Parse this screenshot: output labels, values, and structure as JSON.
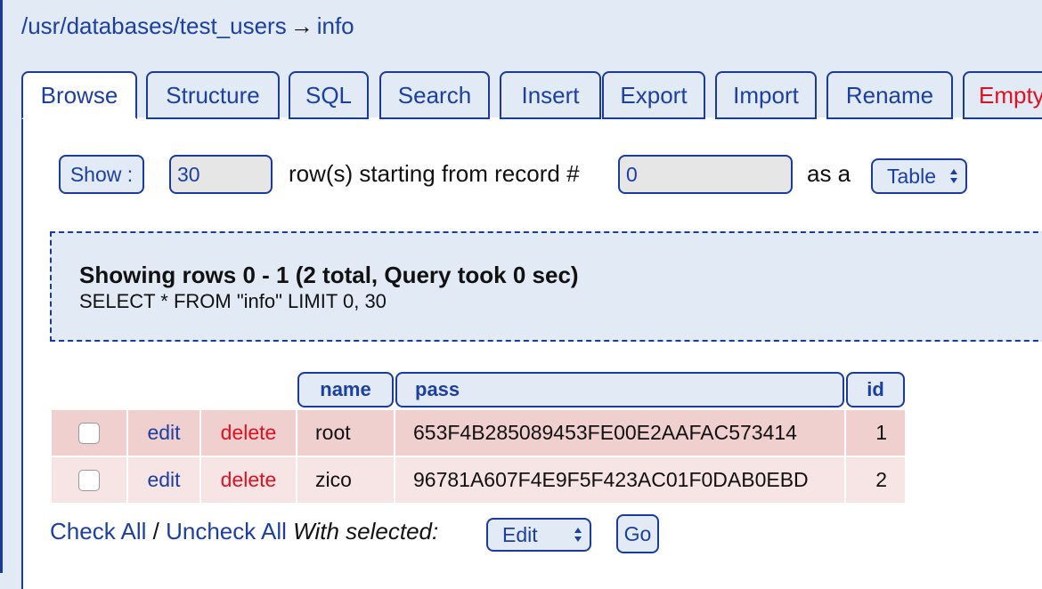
{
  "breadcrumb": {
    "path": "/usr/databases/test_users",
    "arrow": "→",
    "table": "info"
  },
  "tabs": [
    {
      "label": "Browse",
      "active": true
    },
    {
      "label": "Structure"
    },
    {
      "label": "SQL"
    },
    {
      "label": "Search"
    },
    {
      "label": "Insert"
    },
    {
      "label": "Export"
    },
    {
      "label": "Import"
    },
    {
      "label": "Rename"
    },
    {
      "label": "Empty",
      "danger": true
    }
  ],
  "options": {
    "show_button": "Show :",
    "rows_value": "30",
    "starting_label": "row(s) starting from record #",
    "start_value": "0",
    "as_a_label": "as a",
    "view_select": "Table"
  },
  "result": {
    "title": "Showing rows 0 - 1 (2 total, Query took 0 sec)",
    "query": "SELECT * FROM \"info\" LIMIT 0, 30"
  },
  "table": {
    "columns": [
      "name",
      "pass",
      "id"
    ],
    "edit_label": "edit",
    "delete_label": "delete",
    "rows": [
      {
        "name": "root",
        "pass": "653F4B285089453FE00E2AAFAC573414",
        "id": "1"
      },
      {
        "name": "zico",
        "pass": "96781A607F4E9F5F423AC01F0DAB0EBD",
        "id": "2"
      }
    ]
  },
  "bottom": {
    "check_all": "Check All",
    "slash": "/",
    "uncheck_all": "Uncheck All",
    "with_selected": "With selected:",
    "action_select": "Edit",
    "go_button": "Go"
  },
  "colors": {
    "accent": "#1a3a9e",
    "link": "#1b3fa3",
    "danger": "#e2101f",
    "background": "#e1eaf5",
    "row_odd": "#f0cfcf",
    "row_even": "#f7e4e4"
  }
}
